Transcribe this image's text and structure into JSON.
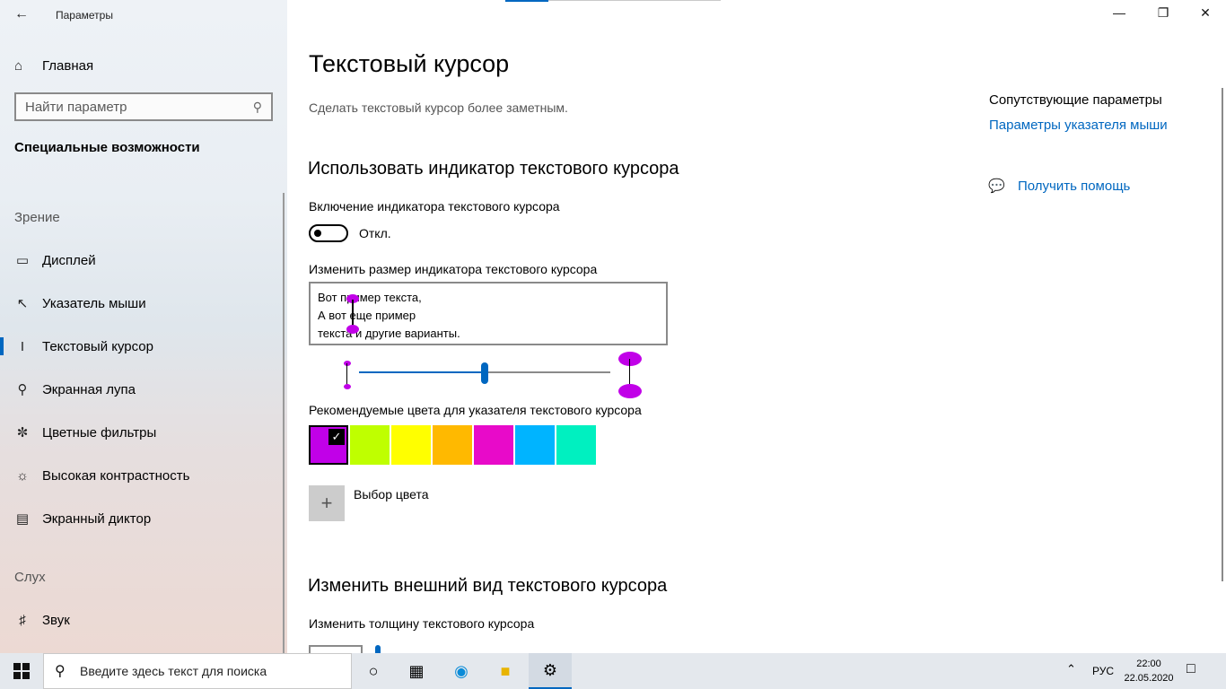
{
  "app": {
    "title": "Параметры"
  },
  "window": {
    "minimize": "—",
    "maximize": "❐",
    "close": "✕"
  },
  "sidebar": {
    "home_label": "Главная",
    "search_placeholder": "Найти параметр",
    "section_title": "Специальные возможности",
    "group_vision": "Зрение",
    "items_vision": [
      {
        "label": "Дисплей",
        "icon": "display-icon"
      },
      {
        "label": "Указатель мыши",
        "icon": "mouse-pointer-icon"
      },
      {
        "label": "Текстовый курсор",
        "icon": "text-cursor-icon",
        "active": true
      },
      {
        "label": "Экранная лупа",
        "icon": "magnifier-icon"
      },
      {
        "label": "Цветные фильтры",
        "icon": "color-filter-icon"
      },
      {
        "label": "Высокая контрастность",
        "icon": "contrast-icon"
      },
      {
        "label": "Экранный диктор",
        "icon": "narrator-icon"
      }
    ],
    "group_hearing": "Слух",
    "items_hearing": [
      {
        "label": "Звук",
        "icon": "speaker-icon"
      }
    ]
  },
  "main": {
    "title": "Текстовый курсор",
    "description": "Сделать текстовый курсор более заметным.",
    "section1_title": "Использовать индикатор текстового курсора",
    "toggle_label": "Включение индикатора текстового курсора",
    "toggle_state": "Откл.",
    "size_label": "Изменить размер индикатора текстового курсора",
    "preview_lines": [
      "Вот пример текста,",
      "А вот еще пример",
      "текста и другие варианты."
    ],
    "size_slider_value": 0.5,
    "colors_label": "Рекомендуемые цвета для указателя текстового курсора",
    "colors": [
      "#c100e8",
      "#bfff00",
      "#ffff00",
      "#ffb900",
      "#e80ac9",
      "#00b4ff",
      "#00f0c0"
    ],
    "selected_color_index": 0,
    "add_color_label": "Выбор цвета",
    "section2_title": "Изменить внешний вид текстового курсора",
    "thickness_label": "Изменить толщину текстового курсора"
  },
  "related": {
    "title": "Сопутствующие параметры",
    "link": "Параметры указателя мыши",
    "help": "Получить помощь"
  },
  "taskbar": {
    "search_placeholder": "Введите здесь текст для поиска",
    "lang": "РУС",
    "time": "22:00",
    "date": "22.05.2020"
  },
  "accent_color": "#0067c0"
}
